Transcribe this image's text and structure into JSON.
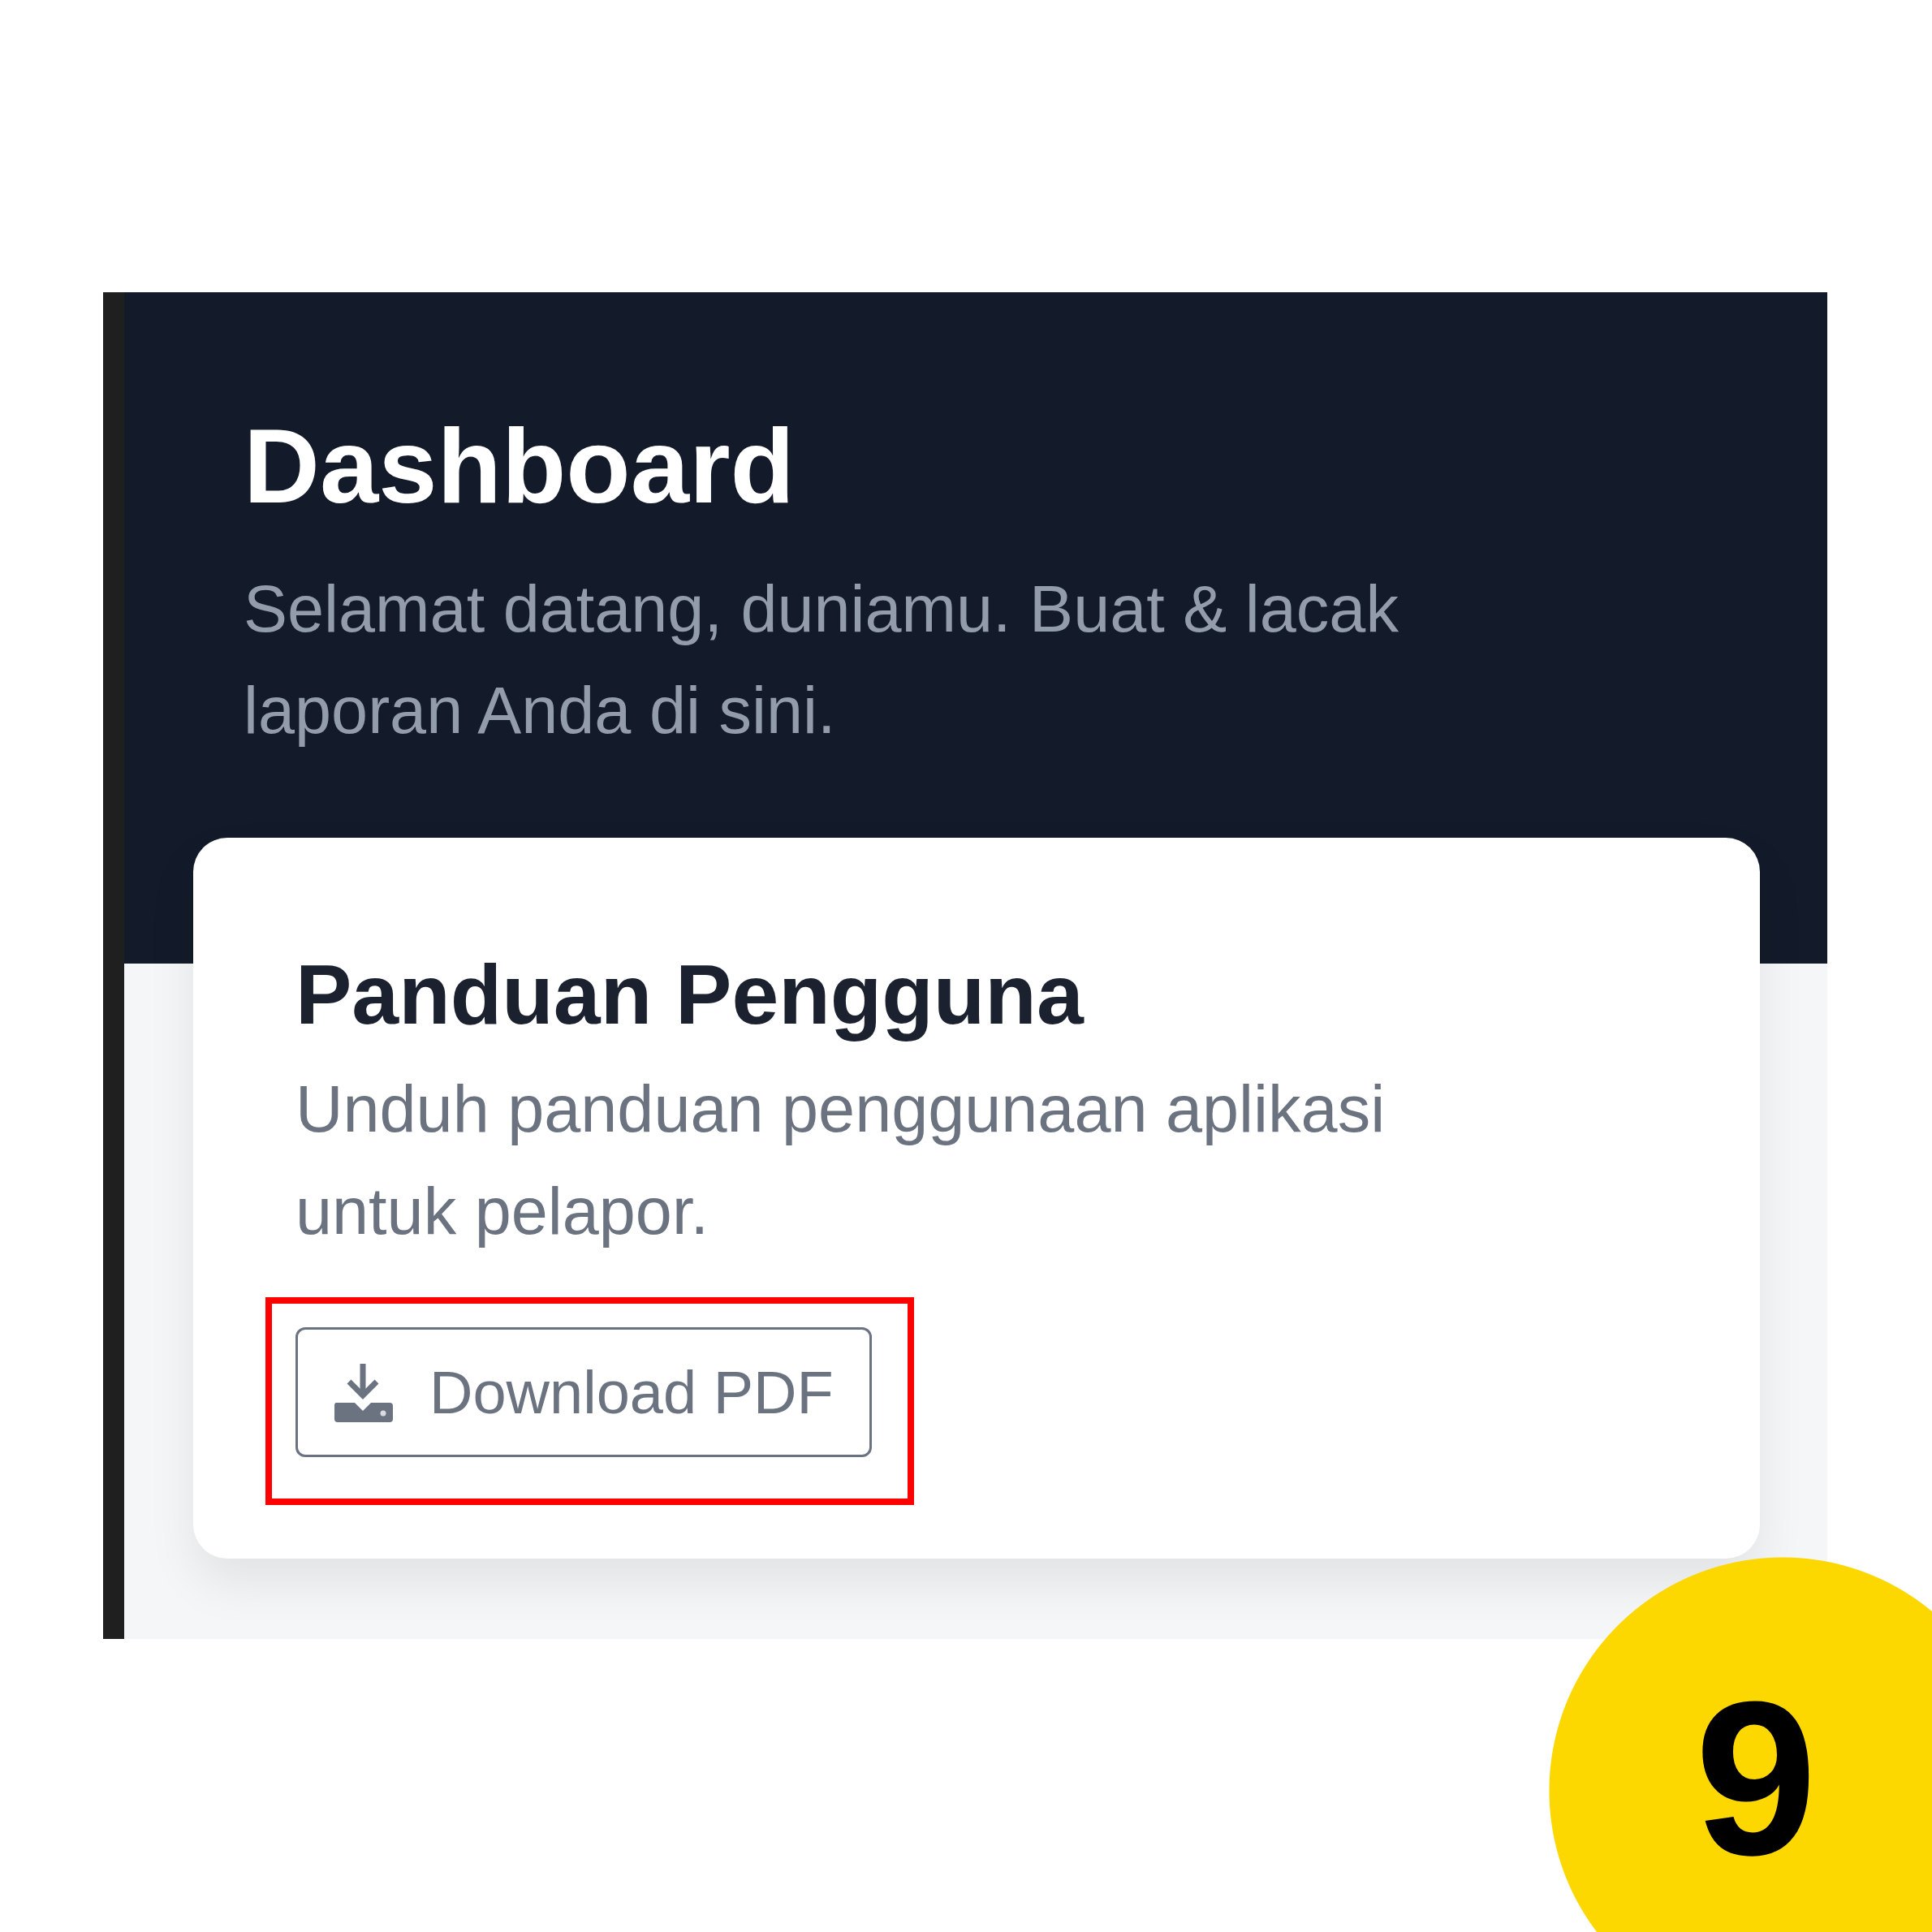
{
  "screen": {
    "title": "Dashboard",
    "subtitle": "Selamat datang, duniamu. Buat & lacak laporan Anda di sini."
  },
  "guide_card": {
    "title": "Panduan Pengguna",
    "description": "Unduh panduan penggunaan aplikasi untuk pelapor.",
    "button": {
      "label": "Download PDF",
      "highlighted": true
    }
  },
  "step_badge": {
    "number": "9"
  }
}
